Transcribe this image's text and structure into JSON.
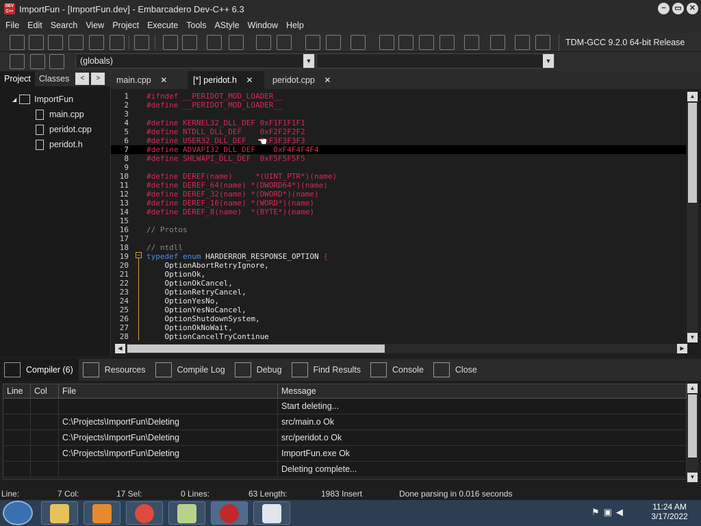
{
  "window": {
    "logo_text": "DEV C++",
    "title": "ImportFun - [ImportFun.dev] - Embarcadero Dev-C++ 6.3",
    "controls": [
      "−",
      "▭",
      "✕"
    ]
  },
  "menu": [
    "File",
    "Edit",
    "Search",
    "View",
    "Project",
    "Execute",
    "Tools",
    "AStyle",
    "Window",
    "Help"
  ],
  "compiler": "TDM-GCC 9.2.0 64-bit Release",
  "globals": "(globals)",
  "left_panel": {
    "tabs": [
      "Project",
      "Classes"
    ],
    "nav": [
      "<",
      ">"
    ],
    "project_name": "ImportFun",
    "files": [
      "main.cpp",
      "peridot.cpp",
      "peridot.h"
    ]
  },
  "editor_tabs": [
    {
      "label": "main.cpp",
      "active": false
    },
    {
      "label": "[*] peridot.h",
      "active": true
    },
    {
      "label": "peridot.cpp",
      "active": false
    }
  ],
  "code": [
    {
      "n": "1",
      "t": "#ifndef __PERIDOT_MOD_LOADER__",
      "c": "pre"
    },
    {
      "n": "2",
      "t": "#define __PERIDOT_MOD_LOADER__",
      "c": "pre"
    },
    {
      "n": "3",
      "t": "",
      "c": "txt"
    },
    {
      "n": "4",
      "t": "#define KERNEL32_DLL_DEF 0xF1F1F1F1",
      "c": "pre"
    },
    {
      "n": "5",
      "t": "#define NTDLL_DLL_DEF    0xF2F2F2F2",
      "c": "pre"
    },
    {
      "n": "6",
      "t": "#define USER32_DLL_DEF   0xF3F3F3F3",
      "c": "pre"
    },
    {
      "n": "7",
      "t": "#define ADVAPI32_DLL_DEF    0xF4F4F4F4",
      "c": "pre",
      "hl": true
    },
    {
      "n": "8",
      "t": "#define SHLWAPI_DLL_DEF  0xF5F5F5F5",
      "c": "pre"
    },
    {
      "n": "9",
      "t": "",
      "c": "txt"
    },
    {
      "n": "10",
      "t": "#define DEREF(name)     *(UINT_PTR*)(name)",
      "c": "pre"
    },
    {
      "n": "11",
      "t": "#define DEREF_64(name) *(DWORD64*)(name)",
      "c": "pre"
    },
    {
      "n": "12",
      "t": "#define DEREF_32(name) *(DWORD*)(name)",
      "c": "pre"
    },
    {
      "n": "13",
      "t": "#define DEREF_16(name) *(WORD*)(name)",
      "c": "pre"
    },
    {
      "n": "14",
      "t": "#define DEREF_8(name)  *(BYTE*)(name)",
      "c": "pre"
    },
    {
      "n": "15",
      "t": "",
      "c": "txt"
    },
    {
      "n": "16",
      "t": "// Protos",
      "c": "cmt"
    },
    {
      "n": "17",
      "t": "",
      "c": "txt"
    },
    {
      "n": "18",
      "t": "// ntdll",
      "c": "cmt"
    },
    {
      "n": "19",
      "t": "",
      "c": "typedef"
    },
    {
      "n": "20",
      "t": "    OptionAbortRetryIgnore,",
      "c": "txt"
    },
    {
      "n": "21",
      "t": "    OptionOk,",
      "c": "txt"
    },
    {
      "n": "22",
      "t": "    OptionOkCancel,",
      "c": "txt"
    },
    {
      "n": "23",
      "t": "    OptionRetryCancel,",
      "c": "txt"
    },
    {
      "n": "24",
      "t": "    OptionYesNo,",
      "c": "txt"
    },
    {
      "n": "25",
      "t": "    OptionYesNoCancel,",
      "c": "txt"
    },
    {
      "n": "26",
      "t": "    OptionShutdownSystem,",
      "c": "txt"
    },
    {
      "n": "27",
      "t": "    OptionOkNoWait,",
      "c": "txt"
    },
    {
      "n": "28",
      "t": "    OptionCancelTryContinue",
      "c": "txt"
    }
  ],
  "typedef_line": {
    "kw1": "typedef",
    "kw2": "enum",
    "name": "HARDERROR_RESPONSE_OPTION",
    "brace": "{"
  },
  "bottom_tabs": [
    "Compiler (6)",
    "Resources",
    "Compile Log",
    "Debug",
    "Find Results",
    "Console",
    "Close"
  ],
  "messages": {
    "headers": [
      "Line",
      "Col",
      "File",
      "Message"
    ],
    "rows": [
      [
        "",
        "",
        "",
        "Start deleting..."
      ],
      [
        "",
        "",
        "C:\\Projects\\ImportFun\\Deleting",
        "src/main.o Ok"
      ],
      [
        "",
        "",
        "C:\\Projects\\ImportFun\\Deleting",
        "src/peridot.o Ok"
      ],
      [
        "",
        "",
        "C:\\Projects\\ImportFun\\Deleting",
        "ImportFun.exe Ok"
      ],
      [
        "",
        "",
        "",
        "Deleting complete..."
      ]
    ]
  },
  "status": {
    "line": "Line:",
    "col": "7 Col:",
    "sel": "17 Sel:",
    "lines": "0 Lines:",
    "length": "63 Length:",
    "insert": "1983 Insert",
    "parse": "Done parsing in 0.016 seconds"
  },
  "tray": {
    "time": "11:24 AM",
    "date": "3/17/2022"
  },
  "colors": {
    "preprocessor": "#d62a55",
    "keyword": "#4a8ce0",
    "comment": "#8a8a8a"
  }
}
